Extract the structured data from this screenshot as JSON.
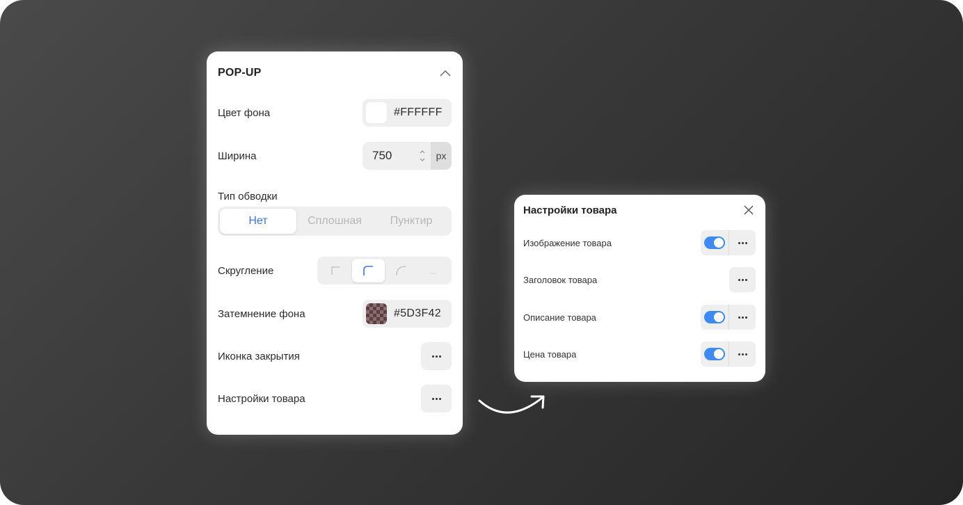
{
  "popup": {
    "title": "POP-UP",
    "collapse_icon": "chevron-up-icon",
    "background_color": {
      "label": "Цвет фона",
      "value": "#FFFFFF",
      "swatch": "#FFFFFF"
    },
    "width": {
      "label": "Ширина",
      "value": "750",
      "unit": "px"
    },
    "border_type": {
      "label": "Тип обводки",
      "options": [
        "Нет",
        "Сплошная",
        "Пунктир"
      ],
      "selected": "Нет"
    },
    "rounding": {
      "label": "Скругление",
      "options": [
        "square-corner-icon",
        "rounded-corner-icon",
        "full-round-corner-icon",
        "more-options"
      ],
      "more_label": "...",
      "selected": "rounded-corner-icon"
    },
    "overlay": {
      "label": "Затемнение фона",
      "value": "#5D3F42",
      "swatch": "#5D3F42"
    },
    "close_icon": {
      "label": "Иконка закрытия"
    },
    "product_settings": {
      "label": "Настройки товара"
    }
  },
  "product_panel": {
    "title": "Настройки товара",
    "close_icon": "close-icon",
    "items": [
      {
        "label": "Изображение товара",
        "toggle": true,
        "enabled": true
      },
      {
        "label": "Заголовок товара",
        "toggle": false
      },
      {
        "label": "Описание товара",
        "toggle": true,
        "enabled": true
      },
      {
        "label": "Цена товара",
        "toggle": true,
        "enabled": true
      }
    ]
  },
  "colors": {
    "accent": "#3B74F0",
    "toggle_on": "#3D8BF2",
    "control_bg": "#EFEFEF"
  }
}
